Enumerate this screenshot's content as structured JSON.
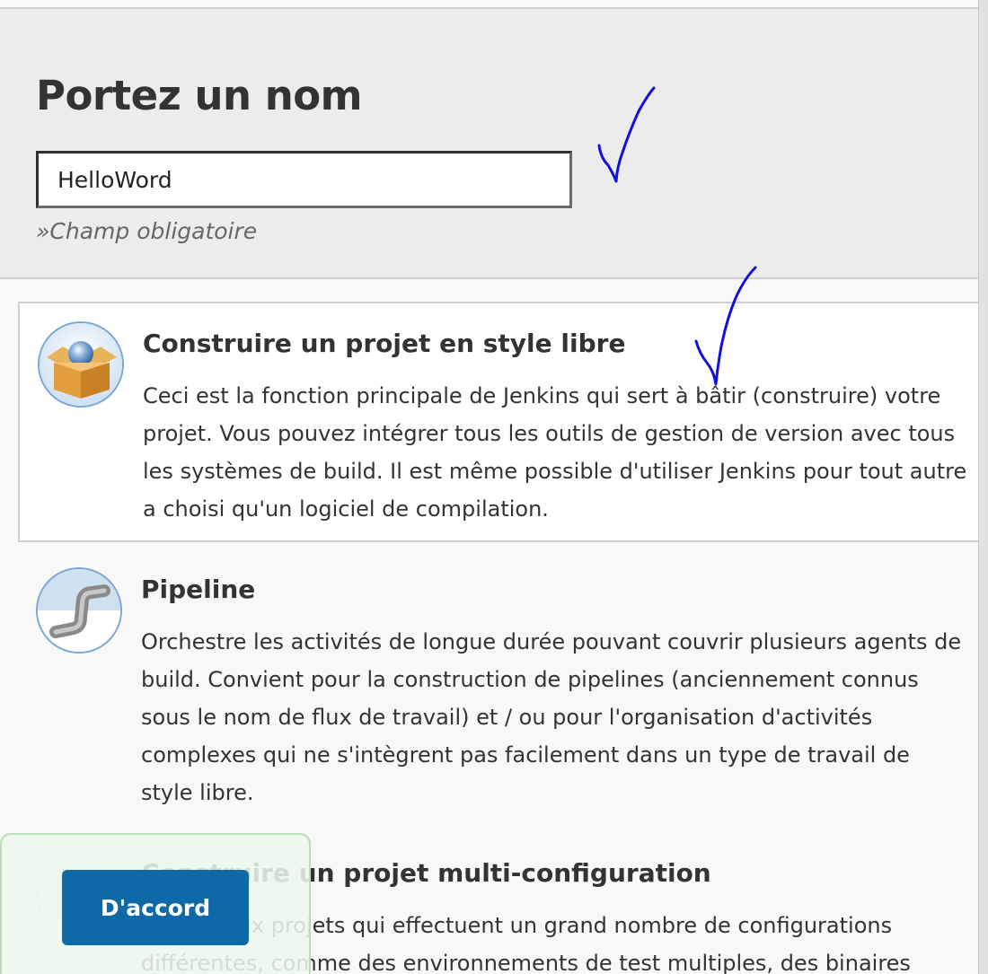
{
  "name_section": {
    "title": "Portez un nom",
    "input_value": "HelloWord",
    "required_hint": "»Champ obligatoire"
  },
  "items": [
    {
      "title": "Construire un projet en style libre",
      "description": "Ceci est la fonction principale de Jenkins qui sert à bâtir (construire) votre projet. Vous pouvez intégrer tous les outils de gestion de version avec tous les systèmes de build. Il est même possible d'utiliser Jenkins pour tout autre a choisi qu'un logiciel de compilation.",
      "icon": "freestyle-box-icon",
      "selected": true
    },
    {
      "title": "Pipeline",
      "description": "Orchestre les activités de longue durée pouvant couvrir plusieurs agents de build. Convient pour la construction de pipelines (anciennement connus sous le nom de flux de travail) et / ou pour l'organisation d'activités complexes qui ne s'intègrent pas facilement dans un type de travail de style libre.",
      "icon": "pipeline-icon",
      "selected": false
    },
    {
      "title": "Construire un projet multi-configuration",
      "description": "Adapté aux projets qui effectuent un grand nombre de configurations différentes, comme des environnements de test multiples, des binaires",
      "icon": "multi-config-icon",
      "selected": false
    }
  ],
  "ok_button": {
    "label": "D'accord"
  },
  "colors": {
    "accent": "#0e6aa6",
    "annotation_ink": "#1010e0"
  }
}
